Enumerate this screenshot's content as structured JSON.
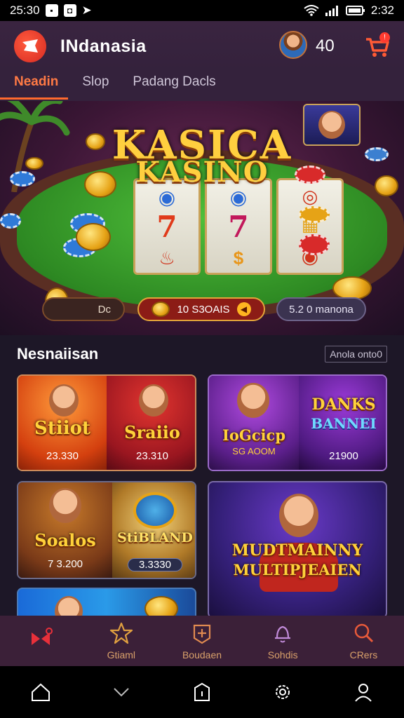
{
  "status_bar": {
    "time": "25:30",
    "right_time": "2:32"
  },
  "header": {
    "app_title": "INdanasia",
    "coin_count": "40",
    "cart_badge": "!"
  },
  "tabs": [
    {
      "label": "Neadin",
      "active": true
    },
    {
      "label": "Slop",
      "active": false
    },
    {
      "label": "Padang Dacls",
      "active": false
    }
  ],
  "hero": {
    "title_line1": "KASICA",
    "title_line2": "KASINO",
    "pill_left": "Dc",
    "pill_mid": "10 S3OAIS",
    "pill_right": "5.2 0 manona"
  },
  "section": {
    "title": "Nesnaiisan",
    "see_all": "Anola onto0"
  },
  "games": [
    {
      "name": "Stiiot",
      "amount": "23.330"
    },
    {
      "name": "Sraiio",
      "amount": "23.310"
    },
    {
      "name": "IoGcicp",
      "sub": "SG AOOM",
      "amount": ""
    },
    {
      "name": "DANKS",
      "sub": "BANNEI",
      "amount": "21900"
    },
    {
      "name": "Soalos",
      "amount": "7 3.200"
    },
    {
      "name": "StiBLAND",
      "amount": "3.3330"
    },
    {
      "name": "MUDTMAINNY",
      "sub": "MULTIPJEAIEN",
      "amount": ""
    }
  ],
  "bottom_nav": [
    {
      "label": "",
      "icon": "flag-icon"
    },
    {
      "label": "Gtiaml",
      "icon": "star-icon"
    },
    {
      "label": "Boudaen",
      "icon": "plus-shield-icon"
    },
    {
      "label": "Sohdis",
      "icon": "bell-icon"
    },
    {
      "label": "CRers",
      "icon": "search-icon"
    }
  ],
  "colors": {
    "accent": "#ff6a2e",
    "header_bg": "#34223c",
    "nav_bg": "#3b2038",
    "gold": "#ffd23a"
  }
}
